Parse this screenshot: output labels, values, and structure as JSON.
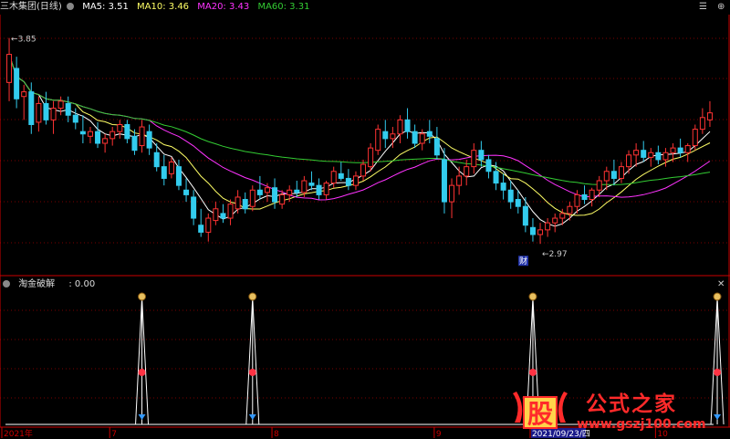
{
  "header": {
    "title": "三木集团(日线)",
    "ma": [
      {
        "label": "MA5: 3.51",
        "color": "#ffffff"
      },
      {
        "label": "MA10: 3.46",
        "color": "#ffff66"
      },
      {
        "label": "MA20: 3.43",
        "color": "#ff33ff"
      },
      {
        "label": "MA60: 3.31",
        "color": "#33cc33"
      }
    ]
  },
  "price_annotations": {
    "high": "3.85",
    "low": "2.97",
    "badge": "财"
  },
  "indicator": {
    "name": "淘金破解",
    "value": ": 0.00"
  },
  "x_axis": [
    {
      "label": "2021年",
      "bar": 0
    },
    {
      "label": "7",
      "bar": 14
    },
    {
      "label": "8",
      "bar": 36
    },
    {
      "label": "9",
      "bar": 58
    },
    {
      "label": "2021/09/23/四",
      "bar": 71,
      "highlight": true
    },
    {
      "label": "10",
      "bar": 88
    }
  ],
  "watermark": {
    "logo_char": "股",
    "title": "公式之家",
    "url": "www.gszj100.com"
  },
  "colors": {
    "up": "#ff3333",
    "down": "#33ccee",
    "grid": "#7a0000",
    "axis": "#cc0000",
    "signal": "#ffffff"
  },
  "chart_data": [
    {
      "type": "candlestick",
      "title": "三木集团(日线)",
      "ylim": [
        2.85,
        3.95
      ],
      "series": [
        {
          "name": "MA5",
          "value": 3.51
        },
        {
          "name": "MA10",
          "value": 3.46
        },
        {
          "name": "MA20",
          "value": 3.43
        },
        {
          "name": "MA60",
          "value": 3.31
        }
      ],
      "ohlc": [
        [
          3.66,
          3.85,
          3.58,
          3.78
        ],
        [
          3.72,
          3.77,
          3.55,
          3.59
        ],
        [
          3.6,
          3.65,
          3.5,
          3.62
        ],
        [
          3.62,
          3.66,
          3.44,
          3.48
        ],
        [
          3.49,
          3.6,
          3.45,
          3.57
        ],
        [
          3.57,
          3.62,
          3.48,
          3.5
        ],
        [
          3.5,
          3.58,
          3.44,
          3.55
        ],
        [
          3.55,
          3.6,
          3.52,
          3.58
        ],
        [
          3.57,
          3.6,
          3.49,
          3.52
        ],
        [
          3.52,
          3.55,
          3.46,
          3.49
        ],
        [
          3.45,
          3.52,
          3.4,
          3.44
        ],
        [
          3.43,
          3.47,
          3.4,
          3.45
        ],
        [
          3.45,
          3.49,
          3.38,
          3.4
        ],
        [
          3.4,
          3.44,
          3.36,
          3.42
        ],
        [
          3.42,
          3.47,
          3.39,
          3.45
        ],
        [
          3.45,
          3.5,
          3.42,
          3.48
        ],
        [
          3.48,
          3.5,
          3.4,
          3.42
        ],
        [
          3.43,
          3.46,
          3.35,
          3.37
        ],
        [
          3.39,
          3.5,
          3.36,
          3.47
        ],
        [
          3.45,
          3.48,
          3.35,
          3.38
        ],
        [
          3.36,
          3.4,
          3.28,
          3.3
        ],
        [
          3.3,
          3.35,
          3.22,
          3.25
        ],
        [
          3.27,
          3.34,
          3.25,
          3.32
        ],
        [
          3.3,
          3.33,
          3.2,
          3.22
        ],
        [
          3.2,
          3.25,
          3.15,
          3.18
        ],
        [
          3.17,
          3.2,
          3.05,
          3.08
        ],
        [
          3.05,
          3.12,
          3.0,
          3.02
        ],
        [
          3.02,
          3.1,
          2.98,
          3.08
        ],
        [
          3.07,
          3.15,
          3.05,
          3.12
        ],
        [
          3.1,
          3.14,
          3.06,
          3.08
        ],
        [
          3.08,
          3.16,
          3.05,
          3.14
        ],
        [
          3.12,
          3.2,
          3.1,
          3.17
        ],
        [
          3.16,
          3.19,
          3.1,
          3.12
        ],
        [
          3.13,
          3.22,
          3.11,
          3.2
        ],
        [
          3.2,
          3.26,
          3.16,
          3.18
        ],
        [
          3.19,
          3.23,
          3.15,
          3.21
        ],
        [
          3.21,
          3.25,
          3.12,
          3.15
        ],
        [
          3.14,
          3.2,
          3.12,
          3.18
        ],
        [
          3.18,
          3.22,
          3.15,
          3.2
        ],
        [
          3.2,
          3.24,
          3.17,
          3.19
        ],
        [
          3.19,
          3.26,
          3.17,
          3.24
        ],
        [
          3.23,
          3.28,
          3.2,
          3.22
        ],
        [
          3.22,
          3.25,
          3.16,
          3.18
        ],
        [
          3.18,
          3.24,
          3.16,
          3.23
        ],
        [
          3.23,
          3.3,
          3.21,
          3.28
        ],
        [
          3.27,
          3.32,
          3.24,
          3.25
        ],
        [
          3.25,
          3.29,
          3.2,
          3.22
        ],
        [
          3.22,
          3.28,
          3.2,
          3.26
        ],
        [
          3.26,
          3.33,
          3.24,
          3.31
        ],
        [
          3.3,
          3.4,
          3.28,
          3.38
        ],
        [
          3.37,
          3.48,
          3.35,
          3.46
        ],
        [
          3.45,
          3.5,
          3.38,
          3.42
        ],
        [
          3.42,
          3.47,
          3.38,
          3.44
        ],
        [
          3.44,
          3.52,
          3.4,
          3.5
        ],
        [
          3.5,
          3.55,
          3.42,
          3.45
        ],
        [
          3.45,
          3.48,
          3.38,
          3.4
        ],
        [
          3.4,
          3.46,
          3.37,
          3.44
        ],
        [
          3.45,
          3.5,
          3.4,
          3.43
        ],
        [
          3.42,
          3.47,
          3.33,
          3.35
        ],
        [
          3.33,
          3.38,
          3.1,
          3.15
        ],
        [
          3.15,
          3.25,
          3.08,
          3.22
        ],
        [
          3.22,
          3.3,
          3.18,
          3.26
        ],
        [
          3.26,
          3.33,
          3.22,
          3.3
        ],
        [
          3.3,
          3.4,
          3.27,
          3.37
        ],
        [
          3.37,
          3.41,
          3.3,
          3.33
        ],
        [
          3.33,
          3.35,
          3.25,
          3.28
        ],
        [
          3.28,
          3.32,
          3.2,
          3.23
        ],
        [
          3.23,
          3.27,
          3.16,
          3.2
        ],
        [
          3.2,
          3.24,
          3.12,
          3.15
        ],
        [
          3.16,
          3.2,
          3.1,
          3.13
        ],
        [
          3.13,
          3.17,
          3.02,
          3.05
        ],
        [
          3.04,
          3.08,
          2.98,
          3.01
        ],
        [
          3.01,
          3.06,
          2.97,
          3.03
        ],
        [
          3.03,
          3.08,
          3.0,
          3.06
        ],
        [
          3.06,
          3.1,
          3.02,
          3.08
        ],
        [
          3.08,
          3.12,
          3.05,
          3.1
        ],
        [
          3.1,
          3.15,
          3.07,
          3.13
        ],
        [
          3.13,
          3.2,
          3.1,
          3.18
        ],
        [
          3.18,
          3.22,
          3.14,
          3.16
        ],
        [
          3.16,
          3.21,
          3.13,
          3.2
        ],
        [
          3.2,
          3.26,
          3.17,
          3.24
        ],
        [
          3.24,
          3.3,
          3.2,
          3.28
        ],
        [
          3.28,
          3.33,
          3.22,
          3.25
        ],
        [
          3.25,
          3.32,
          3.23,
          3.3
        ],
        [
          3.3,
          3.37,
          3.27,
          3.35
        ],
        [
          3.35,
          3.4,
          3.3,
          3.37
        ],
        [
          3.37,
          3.41,
          3.32,
          3.34
        ],
        [
          3.34,
          3.38,
          3.3,
          3.36
        ],
        [
          3.36,
          3.39,
          3.31,
          3.33
        ],
        [
          3.33,
          3.38,
          3.3,
          3.36
        ],
        [
          3.36,
          3.4,
          3.32,
          3.38
        ],
        [
          3.38,
          3.42,
          3.34,
          3.36
        ],
        [
          3.36,
          3.4,
          3.32,
          3.39
        ],
        [
          3.39,
          3.48,
          3.37,
          3.46
        ],
        [
          3.46,
          3.55,
          3.44,
          3.51
        ],
        [
          3.5,
          3.58,
          3.47,
          3.53
        ]
      ]
    },
    {
      "type": "line",
      "title": "淘金破解",
      "value": 0.0,
      "signals_at_bar": [
        18,
        33,
        71,
        96
      ]
    }
  ]
}
